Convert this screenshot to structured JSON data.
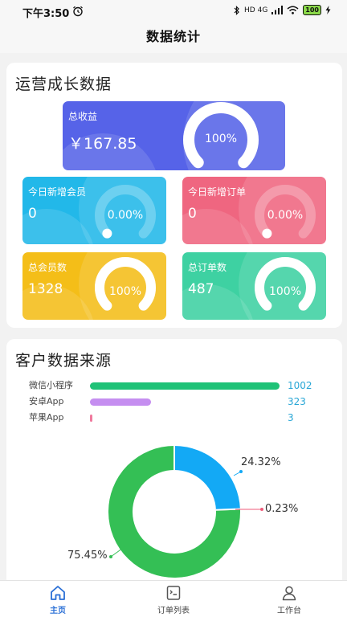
{
  "status_bar": {
    "time": "下午3:50",
    "network": "HD 4G",
    "battery": "100"
  },
  "header": {
    "title": "数据统计"
  },
  "growth": {
    "title": "运营成长数据",
    "total_revenue": {
      "label": "总收益",
      "value": "￥167.85",
      "percent": "100%",
      "fraction": 1.0,
      "color": "#5663e8"
    },
    "today_members": {
      "label": "今日新增会员",
      "value": "0",
      "percent": "0.00%",
      "fraction": 0.0,
      "color": "#22b8e9"
    },
    "today_orders": {
      "label": "今日新增订单",
      "value": "0",
      "percent": "0.00%",
      "fraction": 0.0,
      "color": "#ef6680"
    },
    "total_members": {
      "label": "总会员数",
      "value": "1328",
      "percent": "100%",
      "fraction": 1.0,
      "color": "#f4be18"
    },
    "total_orders": {
      "label": "总订单数",
      "value": "487",
      "percent": "100%",
      "fraction": 1.0,
      "color": "#3ed1a2"
    }
  },
  "source": {
    "title": "客户数据来源",
    "bars": [
      {
        "label": "微信小程序",
        "value": "1002",
        "count": 1002,
        "color": "#1fc277"
      },
      {
        "label": "安卓App",
        "value": "323",
        "count": 323,
        "color": "#c58ef0"
      },
      {
        "label": "苹果App",
        "value": "3",
        "count": 3,
        "color": "#f07a9e"
      }
    ],
    "donut": [
      {
        "label": "24.32%",
        "percent": 24.32,
        "color": "#13a9f5"
      },
      {
        "label": "0.23%",
        "percent": 0.23,
        "color": "#ef5b7a"
      },
      {
        "label": "75.45%",
        "percent": 75.45,
        "color": "#34bf55"
      }
    ]
  },
  "tabs": [
    {
      "label": "主页",
      "icon": "home-icon",
      "active": true
    },
    {
      "label": "订单列表",
      "icon": "order-list-icon",
      "active": false
    },
    {
      "label": "工作台",
      "icon": "user-icon",
      "active": false
    }
  ]
}
